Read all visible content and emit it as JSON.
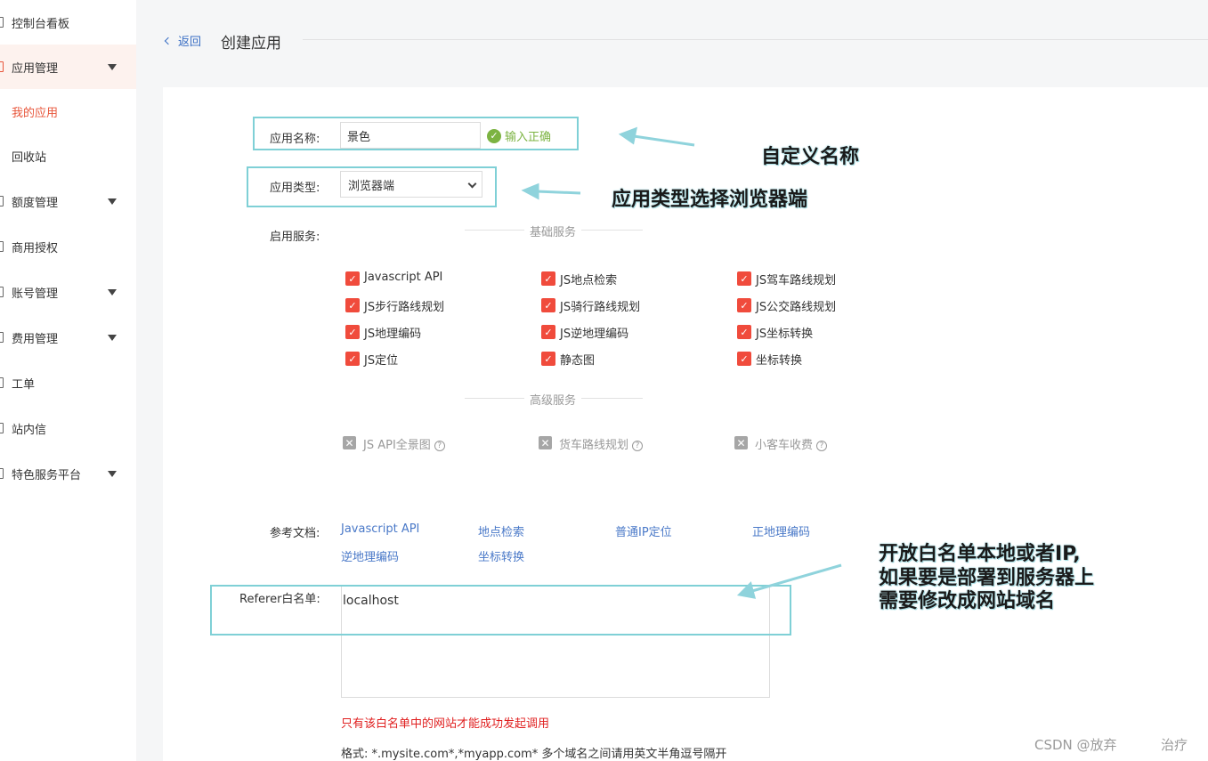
{
  "sidebar": {
    "items": [
      {
        "label": "控制台看板",
        "caret": false
      },
      {
        "label": "应用管理",
        "caret": true
      },
      {
        "label": "我的应用",
        "caret": false
      },
      {
        "label": "回收站",
        "caret": false
      },
      {
        "label": "额度管理",
        "caret": true
      },
      {
        "label": "商用授权",
        "caret": false
      },
      {
        "label": "账号管理",
        "caret": true
      },
      {
        "label": "费用管理",
        "caret": true
      },
      {
        "label": "工单",
        "caret": false
      },
      {
        "label": "站内信",
        "caret": false
      },
      {
        "label": "特色服务平台",
        "caret": true
      }
    ]
  },
  "header": {
    "back_label": "返回",
    "title": "创建应用"
  },
  "form": {
    "app_name_label": "应用名称:",
    "app_name_value": "景色",
    "validation_text": "输入正确",
    "app_type_label": "应用类型:",
    "app_type_value": "浏览器端",
    "services_label": "启用服务:",
    "basic_divider": "基础服务",
    "basic_services": [
      [
        "Javascript API",
        "JS地点检索",
        "JS驾车路线规划"
      ],
      [
        "JS步行路线规划",
        "JS骑行路线规划",
        "JS公交路线规划"
      ],
      [
        "JS地理编码",
        "JS逆地理编码",
        "JS坐标转换"
      ],
      [
        "JS定位",
        "静态图",
        "坐标转换"
      ]
    ],
    "advanced_divider": "高级服务",
    "advanced_services": [
      "JS API全景图",
      "货车路线规划",
      "小客车收费"
    ],
    "docs_label": "参考文档:",
    "docs_links": [
      [
        "Javascript API",
        "地点检索",
        "普通IP定位",
        "正地理编码"
      ],
      [
        "逆地理编码",
        "坐标转换"
      ]
    ],
    "referer_label": "Referer白名单:",
    "referer_value": "localhost",
    "referer_warning": "只有该白名单中的网站才能成功发起调用",
    "referer_format": "格式:  *.mysite.com*,*myapp.com*  多个域名之间请用英文半角逗号隔开"
  },
  "annotations": {
    "name_note": "自定义名称",
    "type_note": "应用类型选择浏览器端",
    "whitelist_note": [
      "开放白名单本地或者IP,",
      "如果要是部署到服务器上",
      "需要修改成网站域名"
    ]
  },
  "watermark": {
    "text": "CSDN @放弃",
    "text2": "治疗"
  },
  "colors": {
    "accent": "#f04b3c",
    "link": "#4a79c8",
    "highlight_box": "#7fd0d6",
    "success": "#7cb342"
  }
}
